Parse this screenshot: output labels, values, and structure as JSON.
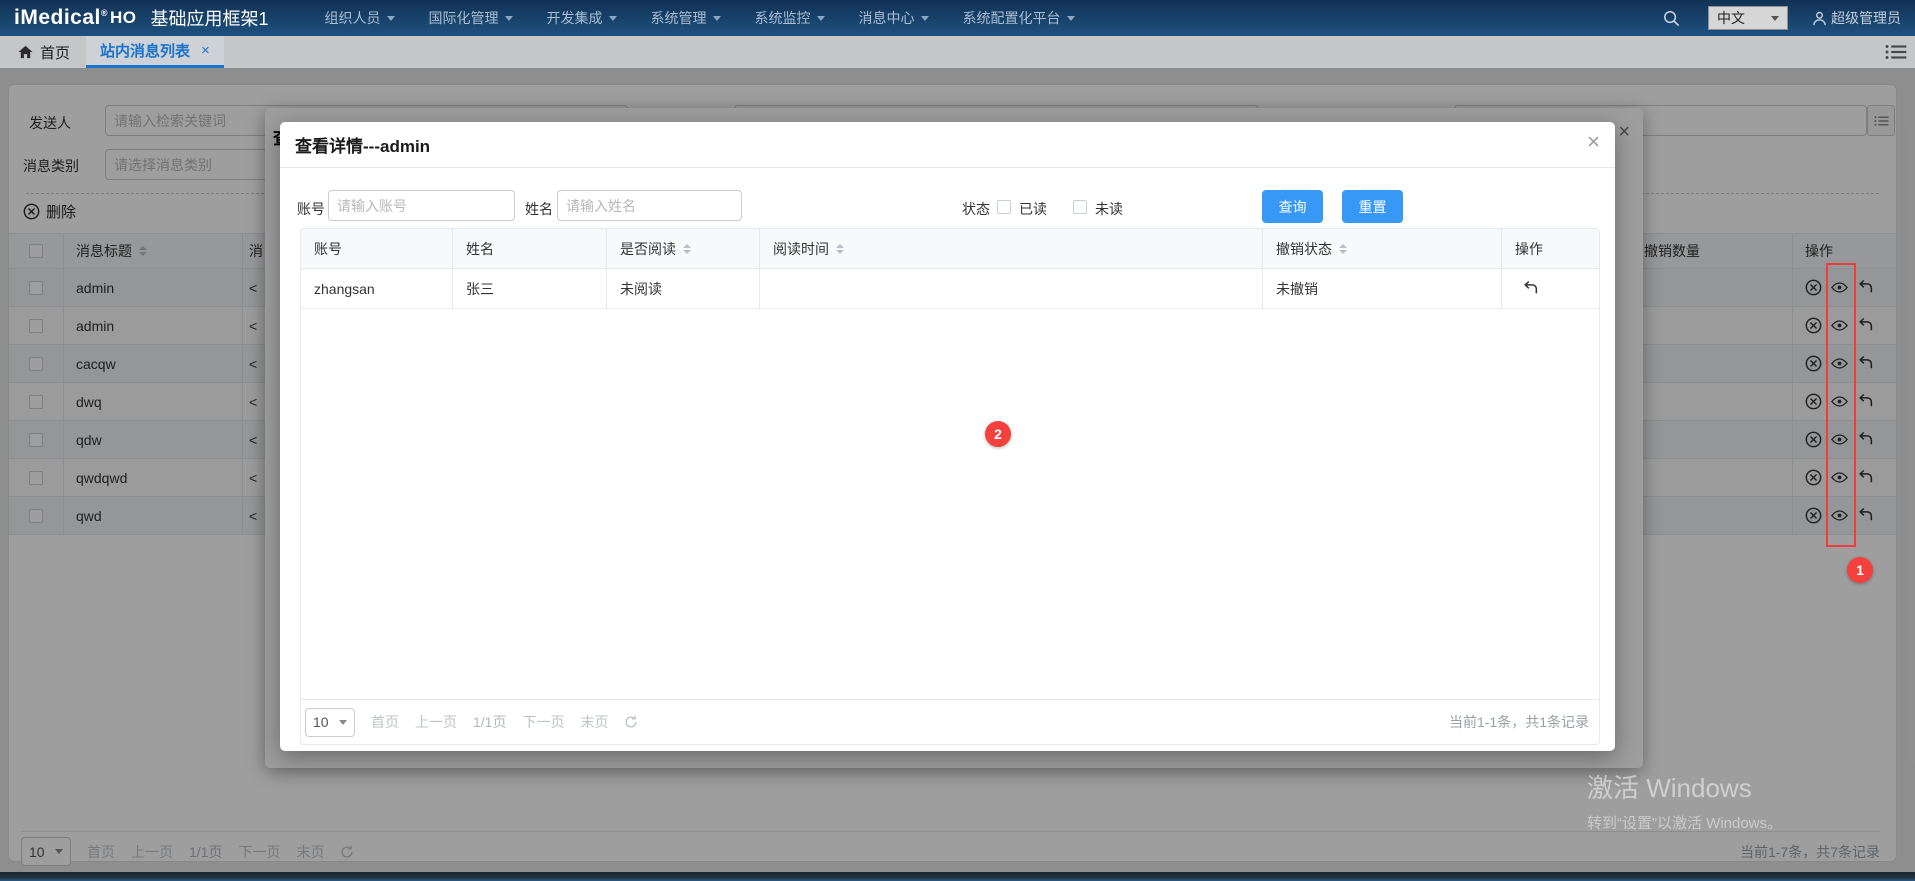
{
  "navbar": {
    "logo_text": "iMedical",
    "logo_reg": "®",
    "logo_suffix": "HO",
    "app_name": "基础应用框架1",
    "menus": [
      "组织人员",
      "国际化管理",
      "开发集成",
      "系统管理",
      "系统监控",
      "消息中心",
      "系统配置化平台"
    ],
    "language_selector": "中文",
    "username": "超级管理员"
  },
  "tabbar": {
    "home_tab": "首页",
    "active_tab": "站内消息列表",
    "close": "×"
  },
  "search_form": {
    "sender_label": "发送人",
    "sender_placeholder": "请输入检索关键词",
    "category_label": "消息类别",
    "category_placeholder": "请选择消息类别"
  },
  "toolbar": {
    "delete_label": "删除"
  },
  "bg_table": {
    "col_title": "消息标题",
    "col_content_partial": "消",
    "col_revoke_count": "撤销数量",
    "col_actions": "操作",
    "rows": [
      {
        "title": "admin",
        "content": "<"
      },
      {
        "title": "admin",
        "content": "<"
      },
      {
        "title": "cacqw",
        "content": "<"
      },
      {
        "title": "dwq",
        "content": "<"
      },
      {
        "title": "qdw",
        "content": "<"
      },
      {
        "title": "qwdqwd",
        "content": "<"
      },
      {
        "title": "qwd",
        "content": "<"
      }
    ]
  },
  "bg_pagination": {
    "page_size": "10",
    "first": "首页",
    "prev": "上一页",
    "current": "1/1页",
    "next": "下一页",
    "last": "末页",
    "summary": "当前1-7条，共7条记录"
  },
  "dialog_behind": {
    "partial_title": "查",
    "close": "×"
  },
  "modal": {
    "title": "查看详情---admin",
    "close": "×",
    "filters": {
      "account_label": "账号",
      "account_placeholder": "请输入账号",
      "name_label": "姓名",
      "name_placeholder": "请输入姓名",
      "status_label": "状态",
      "read_option": "已读",
      "unread_option": "未读",
      "query_button": "查询",
      "reset_button": "重置"
    },
    "table": {
      "columns": [
        "账号",
        "姓名",
        "是否阅读",
        "阅读时间",
        "撤销状态",
        "操作"
      ],
      "rows": [
        {
          "account": "zhangsan",
          "name": "张三",
          "read_status": "未阅读",
          "read_time": "",
          "revoke_status": "未撤销"
        }
      ]
    },
    "pagination": {
      "page_size": "10",
      "first": "首页",
      "prev": "上一页",
      "current": "1/1页",
      "next": "下一页",
      "last": "末页",
      "summary": "当前1-1条，共1条记录"
    }
  },
  "annotations": {
    "badge_1": "1",
    "badge_2": "2"
  },
  "watermark": {
    "line1": "激活 Windows",
    "line2": "转到“设置”以激活 Windows。"
  },
  "colors": {
    "accent_blue": "#3799f5",
    "navbar_top": "#123254",
    "navbar_bottom": "#1d5180",
    "tab_active_blue": "#1a74cd",
    "annotation_red": "#f5413d"
  }
}
